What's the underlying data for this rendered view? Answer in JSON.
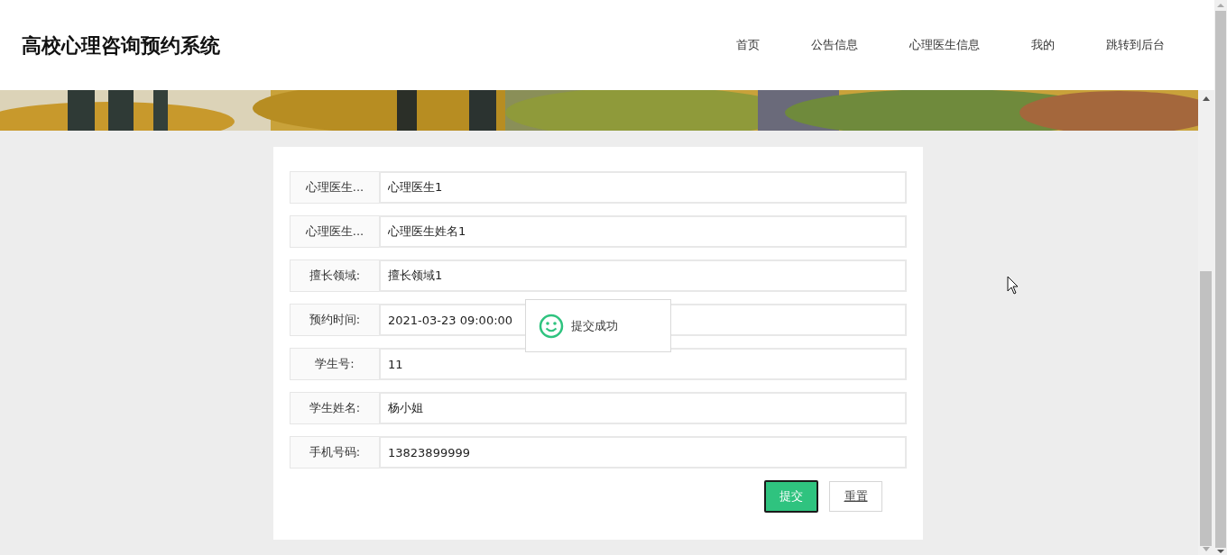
{
  "site_title": "高校心理咨询预约系统",
  "nav": [
    {
      "label": "首页"
    },
    {
      "label": "公告信息"
    },
    {
      "label": "心理医生信息"
    },
    {
      "label": "我的"
    },
    {
      "label": "跳转到后台"
    }
  ],
  "form": {
    "fields": [
      {
        "label": "心理医生...",
        "value": "心理医生1"
      },
      {
        "label": "心理医生...",
        "value": "心理医生姓名1"
      },
      {
        "label": "擅长领域:",
        "value": "擅长领域1"
      },
      {
        "label": "预约时间:",
        "value": "2021-03-23 09:00:00"
      },
      {
        "label": "学生号:",
        "value": "11"
      },
      {
        "label": "学生姓名:",
        "value": "杨小姐"
      },
      {
        "label": "手机号码:",
        "value": "13823899999"
      }
    ],
    "buttons": [
      {
        "label": "提交",
        "kind": "primary"
      },
      {
        "label": "重置",
        "kind": "default"
      }
    ]
  },
  "toast": {
    "message": "提交成功"
  }
}
